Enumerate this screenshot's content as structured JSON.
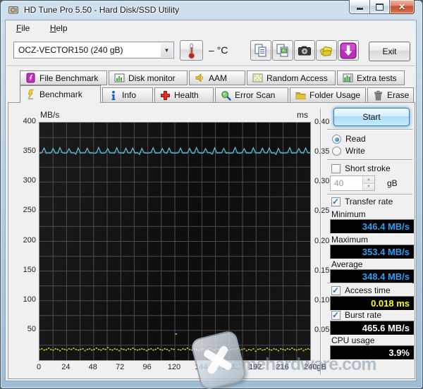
{
  "window": {
    "title": "HD Tune Pro 5.50 - Hard Disk/SSD Utility",
    "app_icon": "hard-disk",
    "controls": [
      "minimize",
      "maximize",
      "close"
    ]
  },
  "menu": {
    "items": [
      {
        "label": "File"
      },
      {
        "label": "Help"
      }
    ]
  },
  "toolbar": {
    "device_select": "OCZ-VECTOR150 (240 gB)",
    "temperature_value": "–",
    "temperature_unit": "°C",
    "buttons": [
      "copy-text",
      "copy-image",
      "screenshot",
      "save-results",
      "download-update"
    ],
    "exit_label": "Exit"
  },
  "tabs": {
    "row1": [
      {
        "label": "File Benchmark",
        "icon": "file-benchmark-icon"
      },
      {
        "label": "Disk monitor",
        "icon": "disk-monitor-icon"
      },
      {
        "label": "AAM",
        "icon": "aam-icon"
      },
      {
        "label": "Random Access",
        "icon": "random-access-icon"
      },
      {
        "label": "Extra tests",
        "icon": "extra-tests-icon"
      }
    ],
    "row2": [
      {
        "label": "Benchmark",
        "icon": "benchmark-icon",
        "active": true
      },
      {
        "label": "Info",
        "icon": "info-icon"
      },
      {
        "label": "Health",
        "icon": "health-icon"
      },
      {
        "label": "Error Scan",
        "icon": "error-scan-icon"
      },
      {
        "label": "Folder Usage",
        "icon": "folder-usage-icon"
      },
      {
        "label": "Erase",
        "icon": "erase-icon"
      }
    ],
    "active": "Benchmark"
  },
  "chart_data": {
    "type": "line",
    "x_range": [
      0,
      240
    ],
    "x_ticks": [
      0,
      24,
      48,
      72,
      96,
      120,
      144,
      168,
      192,
      216,
      240
    ],
    "x_unit": "gB",
    "x_grid_step": 12,
    "left_axis": {
      "label": "MB/s",
      "range": [
        0,
        400
      ],
      "ticks": [
        400,
        350,
        300,
        250,
        200,
        150,
        100,
        50
      ],
      "grid_step": 25
    },
    "right_axis": {
      "label": "ms",
      "range": [
        0,
        0.4
      ],
      "ticks": [
        0.4,
        0.35,
        0.3,
        0.25,
        0.2,
        0.15,
        0.1,
        0.05
      ]
    },
    "grid": true,
    "legend": "none",
    "series": [
      {
        "name": "transfer-rate",
        "axis": "left",
        "style": "line",
        "color": "#5fb8dc",
        "values": [
          348.6,
          349.1,
          357.2,
          348.5,
          349.0,
          348.7,
          356.4,
          348.9,
          348.4,
          357.9,
          349.2,
          348.6,
          349.0,
          356.1,
          348.8,
          349.3,
          346.8,
          357.4,
          348.7,
          349.1,
          348.9,
          356.7,
          348.6,
          349.2,
          348.4,
          349.0,
          358.1,
          348.8,
          348.5,
          349.2,
          356.2,
          348.7,
          349.0,
          348.6,
          357.6,
          348.9,
          349.1,
          348.5,
          356.9,
          349.0,
          348.8,
          357.2,
          348.6,
          349.3,
          346.5,
          356.5,
          349.1,
          348.7,
          348.9,
          349.2,
          357.8,
          348.5,
          349.0,
          348.8,
          356.3,
          349.1,
          348.6,
          357.1,
          348.9,
          349.0,
          348.6,
          349.1,
          357.2,
          348.5,
          349.0,
          348.7,
          356.4,
          348.9,
          348.4,
          357.9,
          349.2,
          348.6,
          349.0,
          356.1,
          348.8,
          349.3,
          346.8,
          357.4,
          348.7,
          349.1,
          348.9,
          356.7,
          348.6,
          349.2,
          348.4,
          349.0,
          358.1,
          348.8,
          348.5,
          349.2,
          356.2,
          348.7,
          349.0,
          348.6,
          357.6,
          348.9,
          349.1,
          348.5,
          356.9,
          349.0,
          348.8,
          357.2,
          348.6,
          349.3,
          346.5,
          356.5,
          349.1,
          348.7,
          348.9,
          349.2,
          357.8,
          348.5,
          349.0,
          348.8,
          356.3,
          349.1,
          348.6,
          357.1,
          348.9,
          349.0
        ]
      },
      {
        "name": "access-time",
        "axis": "right",
        "style": "dots",
        "color": "#c6c632",
        "values": [
          0.018,
          0.019,
          0.017,
          0.018,
          0.02,
          0.018,
          0.017,
          0.019,
          0.018,
          0.016,
          0.019,
          0.018,
          0.017,
          0.019,
          0.018,
          0.02,
          0.018,
          0.017,
          0.018,
          0.019,
          0.016,
          0.018,
          0.019,
          0.017,
          0.018,
          0.02,
          0.018,
          0.017,
          0.019,
          0.018,
          0.021,
          0.018,
          0.017,
          0.019,
          0.018,
          0.016,
          0.019,
          0.018,
          0.017,
          0.019,
          0.018,
          0.02,
          0.018,
          0.017,
          0.018,
          0.019,
          0.018,
          0.016,
          0.018,
          0.019,
          0.017,
          0.018,
          0.02,
          0.018,
          0.017,
          0.019,
          0.018,
          0.016,
          0.019,
          0.018,
          0.044,
          0.018,
          0.017,
          0.019,
          0.018,
          0.02,
          0.018,
          0.017,
          0.019,
          0.018,
          0.016,
          0.018,
          0.019,
          0.017,
          0.018,
          0.02,
          0.018,
          0.017,
          0.019,
          0.018,
          0.016,
          0.019,
          0.018,
          0.017,
          0.018,
          0.019,
          0.018,
          0.02,
          0.017,
          0.018,
          0.019,
          0.016,
          0.018,
          0.017,
          0.019,
          0.015,
          0.018,
          0.019,
          0.017,
          0.018,
          0.02,
          0.018,
          0.017,
          0.019,
          0.018,
          0.016,
          0.019,
          0.018,
          0.017,
          0.019,
          0.018,
          0.02,
          0.018,
          0.017,
          0.018,
          0.019,
          0.016,
          0.018,
          0.019,
          0.018
        ]
      }
    ]
  },
  "controls": {
    "start_label": "Start",
    "mode": {
      "read_label": "Read",
      "write_label": "Write",
      "selected": "Read"
    },
    "short_stroke": {
      "label": "Short stroke",
      "checked": false,
      "capacity_value": "40",
      "capacity_unit": "gB"
    },
    "transfer_rate": {
      "label": "Transfer rate",
      "checked": true,
      "minimum_label": "Minimum",
      "minimum_value": "346.4 MB/s",
      "maximum_label": "Maximum",
      "maximum_value": "353.4 MB/s",
      "average_label": "Average",
      "average_value": "348.4 MB/s"
    },
    "access_time": {
      "label": "Access time",
      "checked": true,
      "value": "0.018 ms"
    },
    "burst_rate": {
      "label": "Burst rate",
      "checked": true,
      "value": "465.6 MB/s"
    },
    "cpu_usage": {
      "label": "CPU usage",
      "value": "3.9%"
    }
  },
  "watermark": {
    "text": "xtremehardware.com"
  },
  "theme": {
    "transfer_value_color": "#2b9ff3",
    "access_value_color": "#ffff00",
    "white_value_color": "#ffffff",
    "line_color": "#5fb8dc",
    "dots_color": "#c6c632",
    "grid_color": "#4c4c4c",
    "chart_bg": "#121212"
  }
}
